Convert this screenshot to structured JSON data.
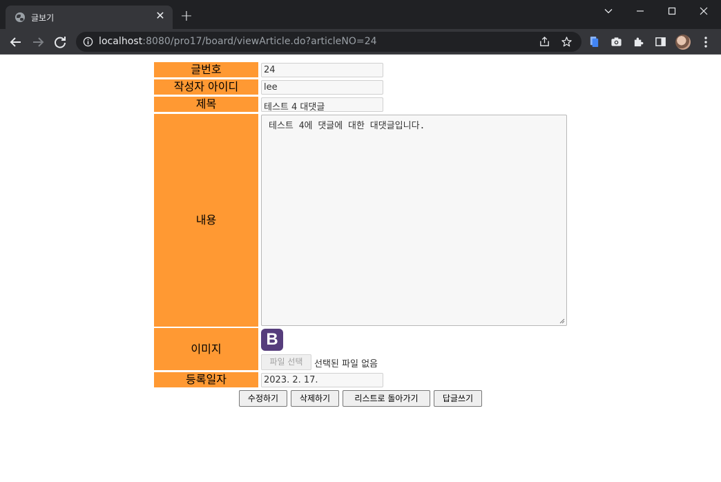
{
  "browser": {
    "tab": {
      "title": "글보기",
      "favicon": "globe-icon"
    },
    "address": {
      "host": "localhost",
      "rest": ":8080/pro17/board/viewArticle.do?articleNO=24"
    }
  },
  "form": {
    "labels": {
      "article_no": "글번호",
      "writer_id": "작성자 아이디",
      "title": "제목",
      "content": "내용",
      "image": "이미지",
      "write_date": "등록일자"
    },
    "values": {
      "article_no": "24",
      "writer_id": "lee",
      "title": "테스트 4 대댓글",
      "content": "테스트 4에 댓글에 대한 대댓글입니다.",
      "image_logo": "B",
      "write_date": "2023. 2. 17."
    },
    "file_input": {
      "button_label": "파일 선택",
      "status": "선택된 파일 없음"
    },
    "buttons": {
      "edit": "수정하기",
      "delete": "삭제하기",
      "back_to_list": "리스트로 돌아가기",
      "reply": "답글쓰기"
    }
  },
  "colors": {
    "label_bg": "#ff9933",
    "logo_bg": "#563d7c"
  }
}
